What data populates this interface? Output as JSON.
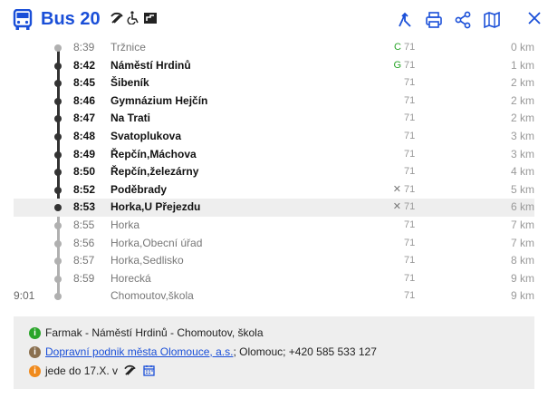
{
  "header": {
    "title": "Bus 20",
    "brand_color": "#1a4fd8",
    "icons": [
      "bus-icon",
      "hammer-pick-icon",
      "wheelchair-icon",
      "low-floor-icon"
    ],
    "tools": [
      "directions-icon",
      "print-icon",
      "share-icon",
      "map-icon",
      "close-icon"
    ]
  },
  "stops": [
    {
      "time": "8:39",
      "name": "Tržnice",
      "mark": "C",
      "line": "71",
      "dist": "0 km",
      "state": "past"
    },
    {
      "time": "8:42",
      "name": "Náměstí Hrdinů",
      "mark": "G",
      "line": "71",
      "dist": "1 km",
      "state": "active"
    },
    {
      "time": "8:45",
      "name": "Šibeník",
      "mark": "",
      "line": "71",
      "dist": "2 km",
      "state": "active"
    },
    {
      "time": "8:46",
      "name": "Gymnázium Hejčín",
      "mark": "",
      "line": "71",
      "dist": "2 km",
      "state": "active"
    },
    {
      "time": "8:47",
      "name": "Na Trati",
      "mark": "",
      "line": "71",
      "dist": "2 km",
      "state": "active"
    },
    {
      "time": "8:48",
      "name": "Svatoplukova",
      "mark": "",
      "line": "71",
      "dist": "3 km",
      "state": "active"
    },
    {
      "time": "8:49",
      "name": "Řepčín,Máchova",
      "mark": "",
      "line": "71",
      "dist": "3 km",
      "state": "active"
    },
    {
      "time": "8:50",
      "name": "Řepčín,železárny",
      "mark": "",
      "line": "71",
      "dist": "4 km",
      "state": "active"
    },
    {
      "time": "8:52",
      "name": "Poděbrady",
      "mark": "✕",
      "line": "71",
      "dist": "5 km",
      "state": "active"
    },
    {
      "time": "8:53",
      "name": "Horka,U Přejezdu",
      "mark": "✕",
      "line": "71",
      "dist": "6 km",
      "state": "active",
      "highlight": true
    },
    {
      "time": "8:55",
      "name": "Horka",
      "mark": "",
      "line": "71",
      "dist": "7 km",
      "state": "past"
    },
    {
      "time": "8:56",
      "name": "Horka,Obecní úřad",
      "mark": "",
      "line": "71",
      "dist": "7 km",
      "state": "past"
    },
    {
      "time": "8:57",
      "name": "Horka,Sedlisko",
      "mark": "",
      "line": "71",
      "dist": "8 km",
      "state": "past"
    },
    {
      "time": "8:59",
      "name": "Horecká",
      "mark": "",
      "line": "71",
      "dist": "9 km",
      "state": "past"
    },
    {
      "time": "",
      "extra": "9:01",
      "name": "Chomoutov,škola",
      "mark": "",
      "line": "71",
      "dist": "9 km",
      "state": "past"
    }
  ],
  "info": {
    "route": "Farmak - Náměstí Hrdinů - Chomoutov, škola",
    "operator_link": "Dopravní podnik města Olomouce, a.s.",
    "operator_rest": "; Olomouc; +420 585 533 127",
    "validity": "jede do 17.X. v",
    "colors": {
      "route": "#2aa52a",
      "operator": "#8a7050",
      "validity": "#f08a1c"
    }
  },
  "colors": {
    "mark_C": "#2aa52a",
    "mark_G": "#2aa52a",
    "mark_x": "#777777",
    "rail_active": "#333333",
    "rail_past": "#b0b0b0"
  }
}
